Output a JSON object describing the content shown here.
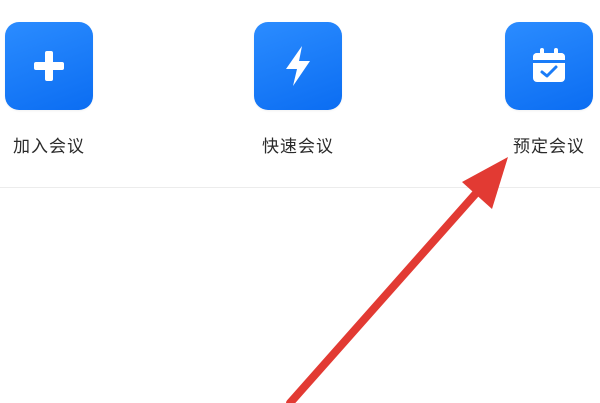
{
  "actions": [
    {
      "id": "join",
      "label": "加入会议",
      "icon": "plus-icon"
    },
    {
      "id": "quick",
      "label": "快速会议",
      "icon": "lightning-icon"
    },
    {
      "id": "schedule",
      "label": "预定会议",
      "icon": "calendar-check-icon"
    }
  ],
  "colors": {
    "tile": "#1a7cf8",
    "arrow": "#e23a33",
    "text": "#2a2a2a"
  }
}
